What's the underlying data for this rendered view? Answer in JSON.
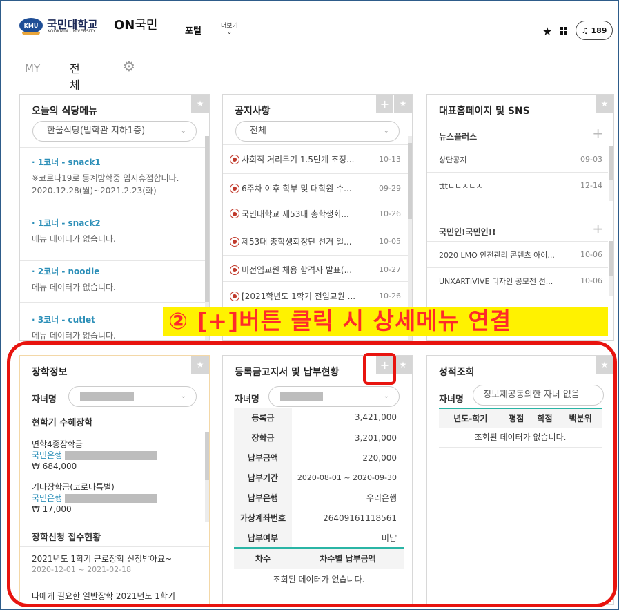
{
  "header": {
    "logo_badge": "KMU",
    "logo_name": "국민대학교",
    "logo_sub": "KOOKMIN UNIVERSITY",
    "on_brand": "ON",
    "on_brand_suffix": "국민",
    "nav_portal": "포털",
    "nav_more": "더보기",
    "star_icon": "star-icon",
    "grid_icon": "grid-icon",
    "bell_icon": "bell-icon",
    "notification_count": "189"
  },
  "tabs": {
    "my": "MY",
    "all": "전체",
    "settings_icon": "gear-icon"
  },
  "cafeteria": {
    "title": "오늘의 식당메뉴",
    "selected_restaurant": "한울식당(법학관 지하1층)",
    "corners": [
      {
        "name": "· 1코너 - snack1",
        "desc": "※코로나19로 동계방학중 임시휴점합니다.",
        "desc2": "2020.12.28(월)~2021.2.23(화)"
      },
      {
        "name": "· 1코너 - snack2",
        "desc": "메뉴 데이터가 없습니다.",
        "desc2": ""
      },
      {
        "name": "· 2코너 - noodle",
        "desc": "메뉴 데이터가 없습니다.",
        "desc2": ""
      },
      {
        "name": "· 3코너 - cutlet",
        "desc": "메뉴 데이터가 없습니다.",
        "desc2": ""
      }
    ]
  },
  "notices": {
    "title": "공지사항",
    "selected_category": "전체",
    "items": [
      {
        "title": "사회적 거리두기 1.5단계 조정...",
        "date": "10-13"
      },
      {
        "title": "6주차 이후 학부 및 대학원 수...",
        "date": "09-29"
      },
      {
        "title": "국민대학교 제53대 총학생회...",
        "date": "10-26"
      },
      {
        "title": "제53대 총학생회장단 선거 일...",
        "date": "10-05"
      },
      {
        "title": "비전임교원 채용 합격자 발표(...",
        "date": "10-27"
      },
      {
        "title": "[2021학년도 1학기 전임교원 ...",
        "date": "10-26"
      }
    ]
  },
  "sns": {
    "title": "대표홈페이지 및 SNS",
    "sections": [
      {
        "name": "뉴스플러스",
        "items": [
          {
            "title": "상단공지",
            "date": "09-03"
          },
          {
            "title": "tttㄷㄷㅈㄷㅈ",
            "date": "12-14"
          }
        ]
      },
      {
        "name": "국민인!국민인!!",
        "items": [
          {
            "title": "2020 LMO 안전관리 콘텐츠 아이...",
            "date": "10-06"
          },
          {
            "title": "UNXARTIVIVE 디자인 공모전 선...",
            "date": "10-06"
          }
        ]
      }
    ]
  },
  "scholarship": {
    "title": "장학정보",
    "child_label": "자녀명",
    "current_label": "현학기 수혜장학",
    "items": [
      {
        "name": "면학4종장학금",
        "bank": "국민은행",
        "amount": "₩ 684,000"
      },
      {
        "name": "기타장학금(코로나특별)",
        "bank": "국민은행",
        "amount": "₩ 17,000"
      }
    ],
    "apply_label": "장학신청 접수현황",
    "apply_items": [
      {
        "name": "2021년도 1학기 근로장학 신청받아요~",
        "period": "2020-12-01 ~ 2021-02-18"
      },
      {
        "name": "나에게 필요한 일반장학 2021년도 1학기",
        "period": ""
      }
    ]
  },
  "tuition": {
    "title": "등록금고지서 및 납부현황",
    "child_label": "자녀명",
    "rows": [
      {
        "key": "등록금",
        "value": "3,421,000"
      },
      {
        "key": "장학금",
        "value": "3,201,000"
      },
      {
        "key": "납부금액",
        "value": "220,000"
      },
      {
        "key": "납부기간",
        "value": "2020-08-01 ~ 2020-09-30"
      },
      {
        "key": "납부은행",
        "value": "우리은행"
      },
      {
        "key": "가상계좌번호",
        "value": "26409161118561"
      },
      {
        "key": "납부여부",
        "value": "미납"
      }
    ],
    "sub_headers": [
      "차수",
      "차수별 납부금액"
    ],
    "empty": "조회된 데이터가 없습니다."
  },
  "grades": {
    "title": "성적조회",
    "child_label": "자녀명",
    "child_select": "정보제공동의한 자녀 없음",
    "headers": [
      "년도-학기",
      "평점",
      "학점",
      "백분위"
    ],
    "empty": "조회된 데이터가 없습니다."
  },
  "annotation": {
    "banner": "② [+]버튼 클릭 시 상세메뉴 연결",
    "accent": "#e8140f",
    "banner_bg": "#fff200"
  }
}
